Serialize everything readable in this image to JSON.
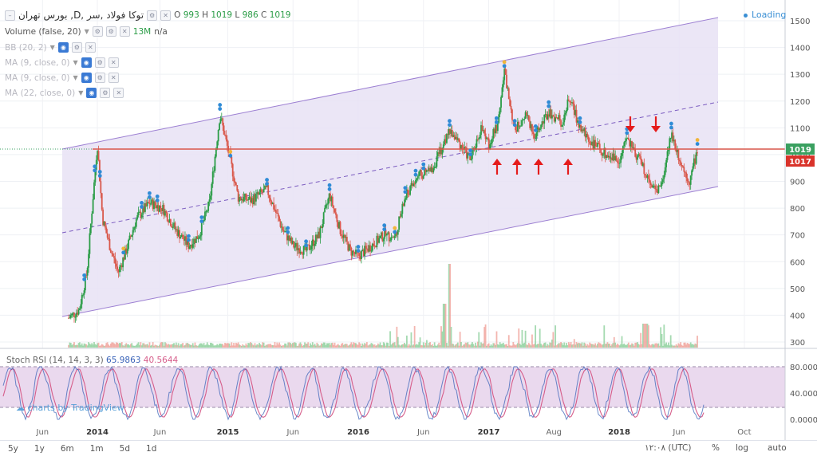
{
  "header": {
    "symbol": "بورس تهران ,D, توکا فولاد ,سر",
    "ohlc": [
      {
        "k": "O",
        "v": "993"
      },
      {
        "k": "H",
        "v": "1019"
      },
      {
        "k": "L",
        "v": "986"
      },
      {
        "k": "C",
        "v": "1019"
      }
    ],
    "status": "Loading"
  },
  "indicators": {
    "volume": {
      "label": "Volume (false, 20)",
      "value": "13M",
      "extra": "n/a"
    },
    "bb": {
      "label": "BB (20, 2)"
    },
    "ma1": {
      "label": "MA (9, close, 0)"
    },
    "ma2": {
      "label": "MA (9, close, 0)"
    },
    "ma3": {
      "label": "MA (22, close, 0)"
    }
  },
  "stoch": {
    "label": "Stoch RSI (14, 14, 3, 3)",
    "k": "65.9863",
    "d": "40.5644"
  },
  "watermark": "charts by TradingView",
  "price_axis": {
    "ticks": [
      "1500",
      "1400",
      "1300",
      "1200",
      "1100",
      "1000",
      "900",
      "800",
      "700",
      "600",
      "500",
      "400",
      "300"
    ],
    "last_price": "1019",
    "ref_price": "1017"
  },
  "stoch_axis": {
    "ticks": [
      "80.0000",
      "40.0000",
      "0.0000"
    ]
  },
  "time_axis": {
    "ticks": [
      "Jun",
      "2014",
      "Jun",
      "2015",
      "Jun",
      "2016",
      "Jun",
      "2017",
      "Aug",
      "2018",
      "Jun",
      "Oct"
    ]
  },
  "toolbar": {
    "ranges": [
      "5y",
      "1y",
      "6m",
      "1m",
      "5d",
      "1d"
    ],
    "clock": "۱۲:۰۸ (UTC)",
    "percent": "%",
    "log": "log",
    "auto": "auto"
  },
  "colors": {
    "channel": "#9c7fd2",
    "channel_fill": "#e7e2f4",
    "hline": "#d9574a",
    "stoch_k": "#3a63b8",
    "stoch_d": "#d65d8a",
    "up": "#2a9c46",
    "down": "#d9574a",
    "arrow": "#e51c1c",
    "marker": "#2f8bd6"
  },
  "chart_data": {
    "type": "candlestick",
    "ylim": [
      270,
      1540
    ],
    "series": [
      {
        "name": "price",
        "points": [
          [
            2013.78,
            390
          ],
          [
            2013.86,
            420
          ],
          [
            2013.92,
            560
          ],
          [
            2013.98,
            920
          ],
          [
            2014.0,
            1040
          ],
          [
            2014.04,
            760
          ],
          [
            2014.1,
            650
          ],
          [
            2014.16,
            560
          ],
          [
            2014.22,
            640
          ],
          [
            2014.3,
            760
          ],
          [
            2014.4,
            820
          ],
          [
            2014.5,
            800
          ],
          [
            2014.6,
            720
          ],
          [
            2014.7,
            660
          ],
          [
            2014.78,
            700
          ],
          [
            2014.86,
            820
          ],
          [
            2014.94,
            1150
          ],
          [
            2015.0,
            1020
          ],
          [
            2015.08,
            840
          ],
          [
            2015.18,
            830
          ],
          [
            2015.3,
            870
          ],
          [
            2015.42,
            720
          ],
          [
            2015.5,
            660
          ],
          [
            2015.6,
            640
          ],
          [
            2015.7,
            700
          ],
          [
            2015.78,
            850
          ],
          [
            2015.86,
            720
          ],
          [
            2015.94,
            640
          ],
          [
            2016.0,
            620
          ],
          [
            2016.1,
            660
          ],
          [
            2016.2,
            700
          ],
          [
            2016.28,
            690
          ],
          [
            2016.36,
            840
          ],
          [
            2016.46,
            920
          ],
          [
            2016.56,
            940
          ],
          [
            2016.62,
            1000
          ],
          [
            2016.7,
            1090
          ],
          [
            2016.78,
            1040
          ],
          [
            2016.86,
            980
          ],
          [
            2016.94,
            1100
          ],
          [
            2017.0,
            1040
          ],
          [
            2017.06,
            1100
          ],
          [
            2017.12,
            1310
          ],
          [
            2017.2,
            1090
          ],
          [
            2017.28,
            1150
          ],
          [
            2017.36,
            1070
          ],
          [
            2017.46,
            1160
          ],
          [
            2017.56,
            1120
          ],
          [
            2017.62,
            1210
          ],
          [
            2017.7,
            1100
          ],
          [
            2017.8,
            1040
          ],
          [
            2017.9,
            1000
          ],
          [
            2018.0,
            980
          ],
          [
            2018.06,
            1060
          ],
          [
            2018.14,
            990
          ],
          [
            2018.2,
            940
          ],
          [
            2018.28,
            860
          ],
          [
            2018.34,
            920
          ],
          [
            2018.4,
            1080
          ],
          [
            2018.48,
            960
          ],
          [
            2018.54,
            900
          ],
          [
            2018.6,
            1019
          ]
        ]
      }
    ],
    "stoch_rsi": {
      "k_last": 65.9863,
      "d_last": 40.5644,
      "levels": [
        80,
        20
      ]
    }
  }
}
